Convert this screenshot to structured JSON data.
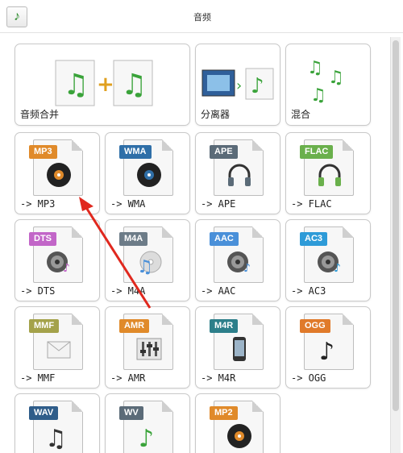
{
  "header": {
    "icon": "music-note-icon",
    "title": "音频"
  },
  "tools": [
    {
      "name": "merge",
      "label": "音频合并"
    },
    {
      "name": "splitter",
      "label": "分离器"
    },
    {
      "name": "mix",
      "label": "混合"
    }
  ],
  "formats": [
    {
      "badge": "MP3",
      "label": "-> MP3",
      "color": "#e08a2a",
      "icon": "disc-icon"
    },
    {
      "badge": "WMA",
      "label": "-> WMA",
      "color": "#2f6fa8",
      "icon": "disc-icon"
    },
    {
      "badge": "APE",
      "label": "-> APE",
      "color": "#5b6b78",
      "icon": "headphones-icon"
    },
    {
      "badge": "FLAC",
      "label": "-> FLAC",
      "color": "#6ab04c",
      "icon": "headphones-icon"
    },
    {
      "badge": "DTS",
      "label": "-> DTS",
      "color": "#c266c8",
      "icon": "speaker-icon"
    },
    {
      "badge": "M4A",
      "label": "-> M4A",
      "color": "#6d7c88",
      "icon": "cd-icon"
    },
    {
      "badge": "AAC",
      "label": "-> AAC",
      "color": "#4a90d9",
      "icon": "speaker-icon"
    },
    {
      "badge": "AC3",
      "label": "-> AC3",
      "color": "#2e9bd8",
      "icon": "speaker-icon"
    },
    {
      "badge": "MMF",
      "label": "-> MMF",
      "color": "#a4a24a",
      "icon": "envelope-icon"
    },
    {
      "badge": "AMR",
      "label": "-> AMR",
      "color": "#e08a2a",
      "icon": "mixer-icon"
    },
    {
      "badge": "M4R",
      "label": "-> M4R",
      "color": "#2d7f8a",
      "icon": "phone-icon"
    },
    {
      "badge": "OGG",
      "label": "-> OGG",
      "color": "#e07a2a",
      "icon": "note-icon"
    },
    {
      "badge": "WAV",
      "label": "",
      "color": "#2f5d8a",
      "icon": "notes-icon"
    },
    {
      "badge": "WV",
      "label": "",
      "color": "#5b6b78",
      "icon": "note-icon"
    },
    {
      "badge": "MP2",
      "label": "",
      "color": "#e08a2a",
      "icon": "disc-icon"
    }
  ],
  "annotation": {
    "color": "#e0281e"
  }
}
